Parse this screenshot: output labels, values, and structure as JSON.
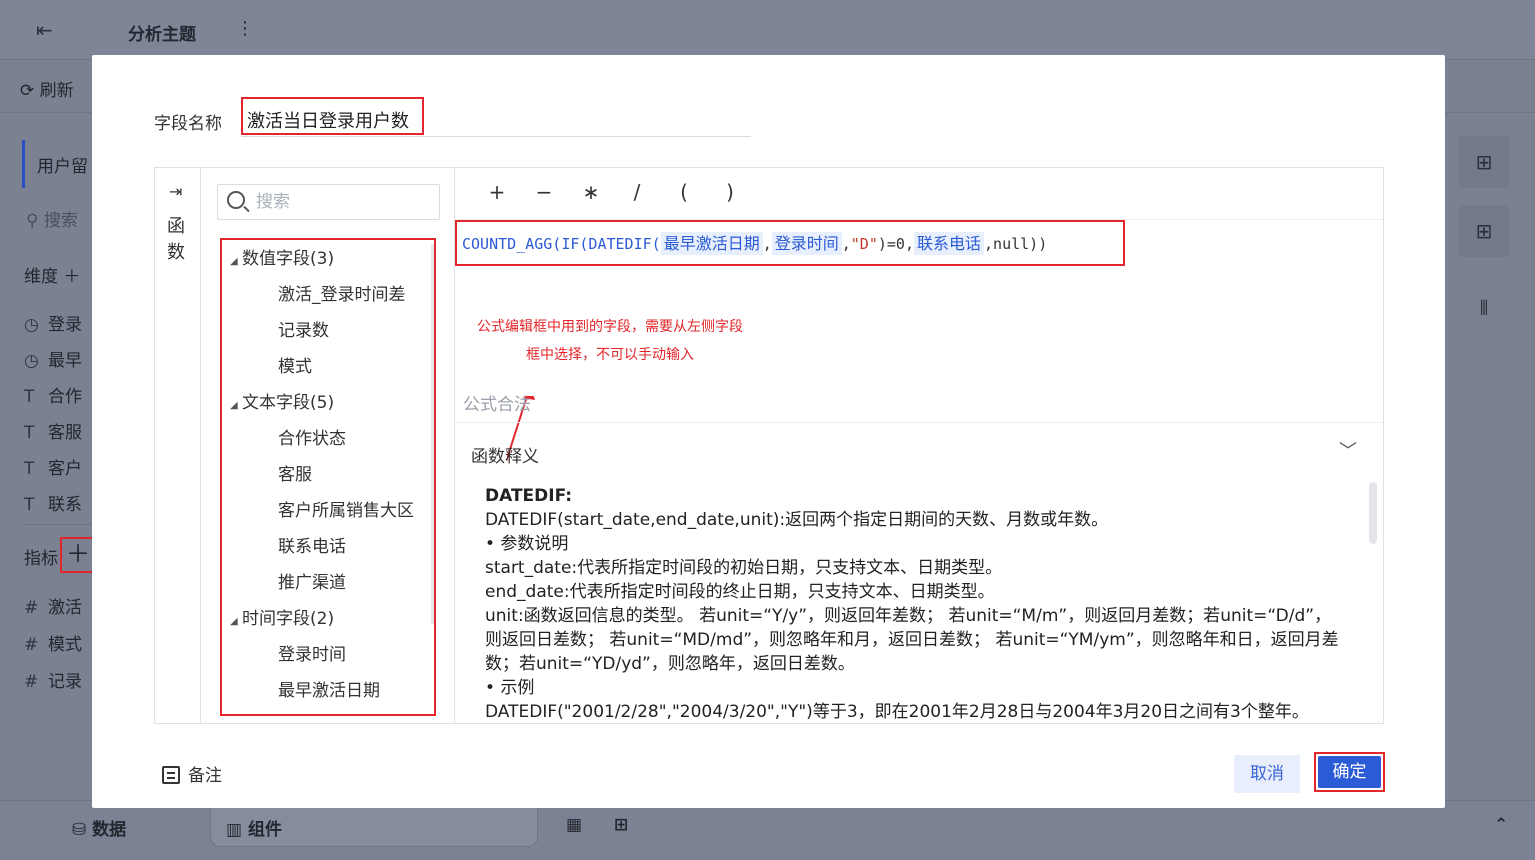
{
  "app": {
    "title": "分析主题",
    "refresh_label": "刷新",
    "tab_label": "用户留",
    "search_placeholder": "搜索",
    "dimension_label": "维度",
    "dimension_items": [
      "登录",
      "最早",
      "合作",
      "客服",
      "客户",
      "联系"
    ],
    "metric_label": "指标",
    "metric_items": [
      "激活",
      "模式",
      "记录"
    ],
    "bottom_data_label": "数据",
    "bottom_component_label": "组件"
  },
  "modal": {
    "field_name_label": "字段名称",
    "field_name_value": "激活当日登录用户数",
    "function_rail_label": "函数",
    "search_placeholder": "搜索",
    "groups": [
      {
        "label": "数值字段(3)",
        "items": [
          "激活_登录时间差",
          "记录数",
          "模式"
        ]
      },
      {
        "label": "文本字段(5)",
        "items": [
          "合作状态",
          "客服",
          "客户所属销售大区",
          "联系电话",
          "推广渠道"
        ]
      },
      {
        "label": "时间字段(2)",
        "items": [
          "登录时间",
          "最早激活日期"
        ]
      }
    ],
    "operators": [
      "+",
      "−",
      "∗",
      "/",
      "(",
      ")"
    ],
    "formula": {
      "p1": "COUNTD_AGG(IF(DATEDIF(",
      "f1": "最早激活日期",
      "c1": ",",
      "f2": "登录时间",
      "c2": ",",
      "s1": "\"D\"",
      "p2": ")=0,",
      "f3": "联系电话",
      "p3": ",null))"
    },
    "annotation": "公式编辑框中用到的字段，需要从左侧字段框中选择，不可以手动输入",
    "valid_text": "公式合法",
    "explain_title": "函数释义",
    "explain": {
      "heading": "DATEDIF:",
      "lines": [
        "DATEDIF(start_date,end_date,unit):返回两个指定日期间的天数、月数或年数。",
        "• 参数说明",
        "start_date:代表所指定时间段的初始日期，只支持文本、日期类型。",
        "end_date:代表所指定时间段的终止日期，只支持文本、日期类型。",
        "unit:函数返回信息的类型。 若unit=“Y/y”，则返回年差数； 若unit=“M/m”，则返回月差数；若unit=“D/d”，则返回日差数； 若unit=“MD/md”，则忽略年和月，返回日差数； 若unit=“YM/ym”，则忽略年和日，返回月差数；若unit=“YD/yd”，则忽略年，返回日差数。",
        "• 示例",
        "DATEDIF(\"2001/2/28\",\"2004/3/20\",\"Y\")等于3，即在2001年2月28日与2004年3月20日之间有3个整年。"
      ]
    },
    "note_label": "备注",
    "cancel_label": "取消",
    "ok_label": "确定"
  }
}
